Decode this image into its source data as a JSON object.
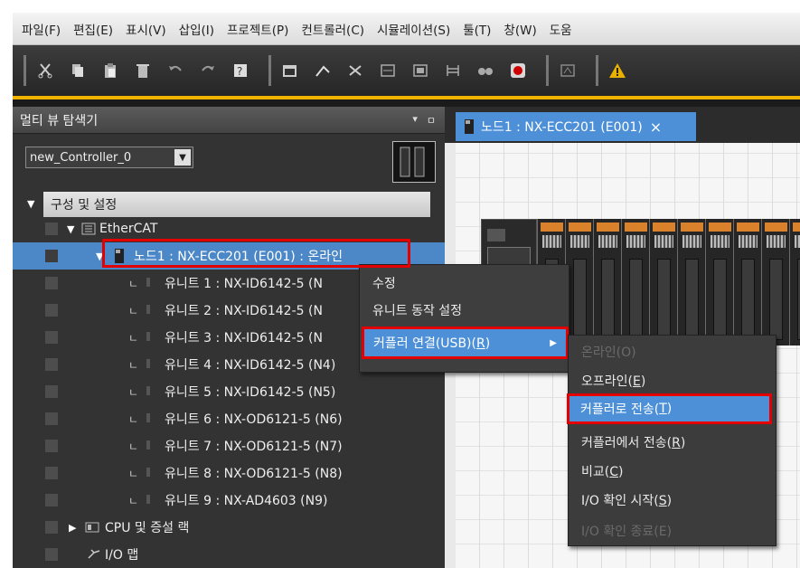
{
  "menubar": {
    "items": [
      "파일(F)",
      "편집(E)",
      "표시(V)",
      "삽입(I)",
      "프로젝트(P)",
      "컨트롤러(C)",
      "시뮬레이션(S)",
      "툴(T)",
      "창(W)",
      "도움"
    ]
  },
  "toolbar": {
    "icons": [
      "cut-icon",
      "copy-icon",
      "paste-icon",
      "delete-icon",
      "undo-icon",
      "redo-icon",
      "help-icon",
      "window-icon",
      "pen-icon",
      "cross-ref-icon",
      "compare-icon",
      "build-icon",
      "ladder-icon",
      "find-icon",
      "stop-icon",
      "monitor-icon",
      "warning-icon"
    ]
  },
  "explorer": {
    "title": "멀티 뷰 탐색기",
    "header_ctrls": [
      "▾",
      "ㅁ"
    ],
    "controller": "new_Controller_0",
    "tree": {
      "config": "구성 및 설정",
      "ethercat": "EtherCAT",
      "node": "노드1 : NX-ECC201 (E001) : 온라인",
      "units": [
        "유니트 1 : NX-ID6142-5 (N",
        "유니트 2 : NX-ID6142-5 (N",
        "유니트 3 : NX-ID6142-5 (N",
        "유니트 4 : NX-ID6142-5 (N4)",
        "유니트 5 : NX-ID6142-5 (N5)",
        "유니트 6 : NX-OD6121-5 (N6)",
        "유니트 7 : NX-OD6121-5 (N7)",
        "유니트 8 : NX-OD6121-5 (N8)",
        "유니트 9 : NX-AD4603 (N9)"
      ],
      "cpu_rack": "CPU 및 증설 랙",
      "io_map": "I/O 맵"
    }
  },
  "doc_tab": {
    "label": "노드1 : NX-ECC201 (E001)",
    "close": "×"
  },
  "context_menu": {
    "edit": "수정",
    "unit_settings": "유니트 동작 설정",
    "connect": "커플러 연결(USB)(",
    "connect_key": "R",
    "connect_tail": ")"
  },
  "submenu": {
    "online": "온라인(O)",
    "offline_base": "오프라인(",
    "offline_key": "E",
    "transfer_to_base": "커플러로 전송(",
    "transfer_to_key": "T",
    "transfer_from_base": "커플러에서 전송(",
    "transfer_from_key": "R",
    "compare_base": "비교(",
    "compare_key": "C",
    "io_check_base": "I/O 확인 시작(",
    "io_check_key": "S",
    "io_check_end": "I/O 확인 종료(E)",
    "close_paren": ")"
  },
  "colors": {
    "accent": "#f0b400",
    "highlight": "#4d90d8",
    "callout": "#e40000"
  }
}
